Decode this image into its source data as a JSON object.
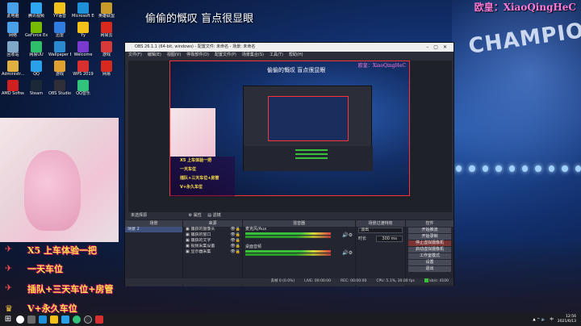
{
  "overlay": {
    "center_title": "偷偷的慨叹 盲点很显眼",
    "top_right": "欧皇：XiaoQingHeC"
  },
  "promo": {
    "lines": [
      "X5 上车体验一把",
      "一天车位",
      "插队+三天车位+房管",
      "V+永久车位"
    ]
  },
  "desktop_icons": [
    {
      "label": "此电脑",
      "color": "#4aa0e8"
    },
    {
      "label": "腾讯视频",
      "color": "#2fa6f2"
    },
    {
      "label": "YY语音",
      "color": "#f3c21a"
    },
    {
      "label": "Microsoft Edge",
      "color": "#1f8fd8"
    },
    {
      "label": "英雄联盟",
      "color": "#c79a2a"
    },
    {
      "label": "网络",
      "color": "#4aa0e8"
    },
    {
      "label": "GeForce Experience",
      "color": "#76b900"
    },
    {
      "label": "迅雷",
      "color": "#2f7de1"
    },
    {
      "label": "Yy",
      "color": "#f3c21a"
    },
    {
      "label": "网易云",
      "color": "#d8291f"
    },
    {
      "label": "回收站",
      "color": "#7fa8c8"
    },
    {
      "label": "网易UU",
      "color": "#2fbf6a"
    },
    {
      "label": "Wallpaper Engine",
      "color": "#2a8ad0"
    },
    {
      "label": "Welcome",
      "color": "#7a3ad0"
    },
    {
      "label": "游戏",
      "color": "#d83a3a"
    },
    {
      "label": "Administr...",
      "color": "#e0b040"
    },
    {
      "label": "QQ",
      "color": "#2aa0e8"
    },
    {
      "label": "游戏",
      "color": "#e0a030"
    },
    {
      "label": "WPS 2019",
      "color": "#d83030"
    },
    {
      "label": "网易",
      "color": "#d8291f"
    },
    {
      "label": "AMD Software",
      "color": "#d02020"
    },
    {
      "label": "Steam",
      "color": "#1b2838"
    },
    {
      "label": "OBS Studio",
      "color": "#302f38"
    },
    {
      "label": "QQ音乐",
      "color": "#31c27c"
    }
  ],
  "obs": {
    "title": "OBS 26.1.1 (64-bit, windows) - 配置文件: 未命名 - 场景: 未命名",
    "menu": [
      "文件(F)",
      "编辑(E)",
      "视图(V)",
      "停靠部件(D)",
      "配置文件(P)",
      "场景集合(S)",
      "工具(T)",
      "帮助(H)"
    ],
    "preview_title": "偷偷的慨叹 盲点很显眼",
    "preview_tr": "欧皇：XiaoQingHeC",
    "preview_promo": [
      "X5 上车体验一把",
      "一天车位",
      "插队+三天车位+房管",
      "V+永久车位"
    ],
    "toolbar": "未选择源",
    "props_btn": "属性",
    "filter_btn": "滤镜",
    "panels": {
      "scenes_title": "场景",
      "sources_title": "来源",
      "mixer_title": "混音器",
      "transitions_title": "场景过渡特效",
      "controls_title": "控件"
    },
    "scenes": [
      "场景 2"
    ],
    "sources": [
      "捕获的摄像头",
      "捕获的窗口",
      "捕获的文字",
      "视频采集设备",
      "显示器采集"
    ],
    "mixer": [
      {
        "name": "麦克风/Aux"
      },
      {
        "name": "桌面音频"
      }
    ],
    "transition": {
      "type": "淡出",
      "duration_label": "时长",
      "duration": "300 ms"
    },
    "controls": [
      "开始推流",
      "开始录制",
      "停止虚拟摄像机",
      "启动虚拟摄像机",
      "工作室模式",
      "设置",
      "退出"
    ],
    "status": [
      "丢帧 0 (0.0%)",
      "LIVE: 00:00:00",
      "REC: 00:00:00",
      "CPU: 5.1%, 30.00 fps",
      "kb/s: 4100"
    ]
  },
  "taskbar": {
    "time": "12:56",
    "date": "2021/6/13"
  }
}
